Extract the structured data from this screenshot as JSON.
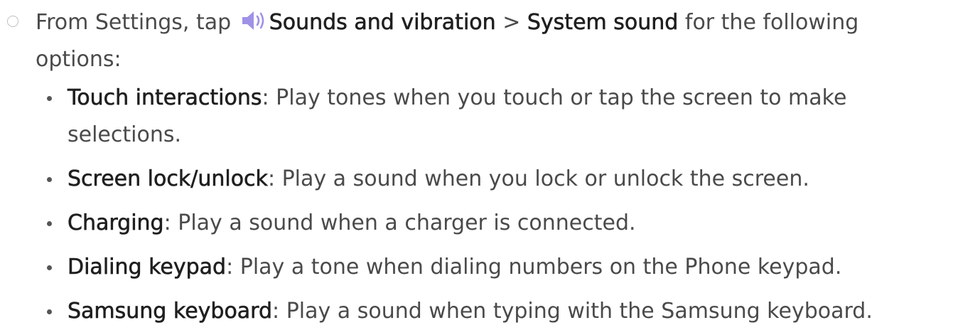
{
  "step": {
    "prefix": "From Settings, tap ",
    "icon": "speaker-icon",
    "icon_color": "#9f92e6",
    "menu_1": "Sounds and vibration",
    "separator": " > ",
    "menu_2": "System sound",
    "suffix_line1": " for the following",
    "suffix_line2": "options:"
  },
  "items": [
    {
      "term": "Touch interactions",
      "line1": ": Play tones when you touch or tap the screen to make",
      "line2": "selections."
    },
    {
      "term": "Screen lock/unlock",
      "line1": ": Play a sound when you lock or unlock the screen."
    },
    {
      "term": "Charging",
      "line1": ": Play a sound when a charger is connected."
    },
    {
      "term": "Dialing keypad",
      "line1": ": Play a tone when dialing numbers on the Phone keypad."
    },
    {
      "term": "Samsung keyboard",
      "line1": ": Play a sound when typing with the Samsung keyboard."
    }
  ]
}
